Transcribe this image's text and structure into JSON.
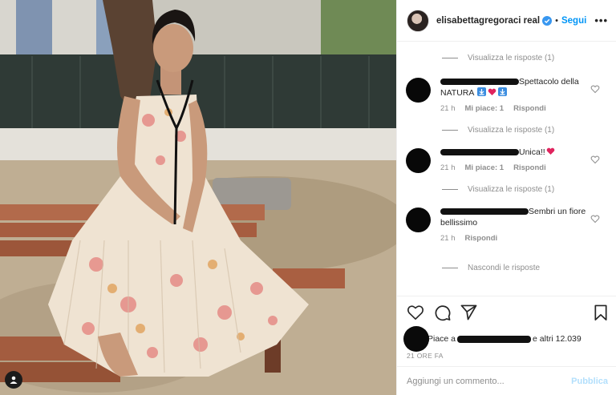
{
  "post": {
    "username": "elisabettagregoraci real",
    "follow_label": "Segui",
    "more_label": "•••",
    "separator": "•"
  },
  "comments": {
    "view_replies_1": "Visualizza le risposte (1)",
    "items": [
      {
        "text_visible": "Spettacolo della NATURA",
        "time": "21 h",
        "likes": "Mi piace: 1",
        "reply": "Rispondi"
      },
      {
        "text_visible": "Unica!!",
        "time": "21 h",
        "likes": "Mi piace: 1",
        "reply": "Rispondi"
      },
      {
        "text_visible": "Sembri un fiore bellissimo",
        "time": "21 h",
        "reply": "Rispondi"
      }
    ],
    "view_replies_2": "Visualizza le risposte (1)",
    "view_replies_3": "Visualizza le risposte (1)",
    "hide_replies": "Nascondi le risposte"
  },
  "likes": {
    "prefix": "Piace a",
    "suffix": "e altri 12.039"
  },
  "timestamp": "21 ORE FA",
  "add_comment": {
    "placeholder": "Aggiungi un commento...",
    "publish_label": "Pubblica"
  },
  "colors": {
    "accent": "#0095f6",
    "publish_disabled": "#b2dffc",
    "verified": "#3897f0",
    "muted": "#8e8e8e"
  }
}
